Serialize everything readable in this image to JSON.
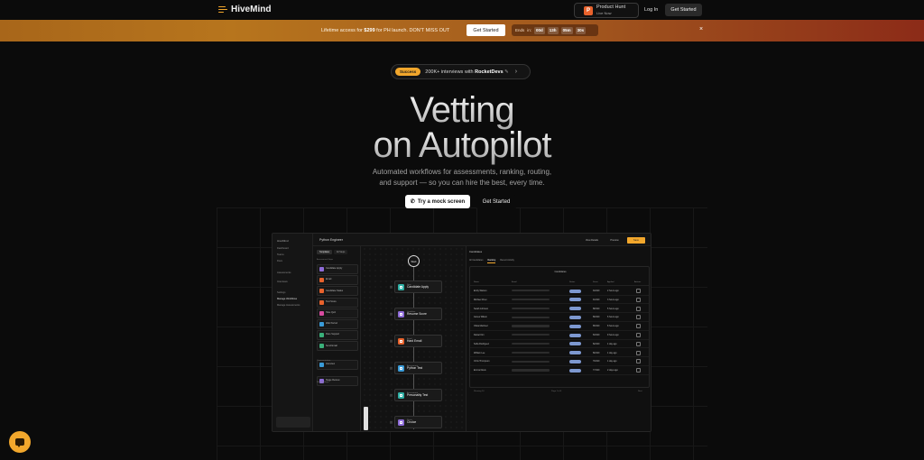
{
  "nav": {
    "brand": "HiveMind",
    "product_hunt_title": "Product Hunt",
    "product_hunt_sub": "Live Now",
    "product_hunt_icon": "P",
    "login": "Log In",
    "get_started": "Get Started"
  },
  "banner": {
    "text_pre": "Lifetime access for ",
    "price": "$299",
    "text_post": " for PH launch. DON'T MISS OUT",
    "button": "Get Started",
    "ends_label": "Ends",
    "ends_in": "in:",
    "days": "00d",
    "hours": "13h",
    "minutes": "05m",
    "seconds": "30s",
    "close": "×"
  },
  "hero": {
    "pill_tag": "Success",
    "pill_text_pre": "200K+ interviews with ",
    "pill_text_bold": "RocketDevs",
    "pill_arrow": "›",
    "title_line1": "Vetting",
    "title_line2": "on Autopilot",
    "subtitle_line1": "Automated workflows for assessments, ranking, routing,",
    "subtitle_line2": "and support — so you can hire the best, every time.",
    "cta_primary": "Try a mock screen",
    "cta_secondary": "Get Started"
  },
  "app": {
    "side_logo": "HiveMind",
    "side_items": [
      "Dashboard",
      "Teams",
      "Docs",
      "Assessments",
      "Interviews",
      "Settings",
      "Manage Workflows",
      "Manage Assessments"
    ],
    "workflow_title": "Python Engineer",
    "top_buttons": [
      "View Details",
      "Preview",
      "Save"
    ],
    "step_tabs": [
      "Templates",
      "All Steps"
    ],
    "steps": [
      {
        "label": "Candidate Apply",
        "color": "#8e6bd8"
      },
      {
        "label": "Email",
        "color": "#e8622c"
      },
      {
        "label": "Candidate Status",
        "color": "#e8622c"
      },
      {
        "label": "Test Score",
        "color": "#e8622c"
      },
      {
        "label": "Take Quiz",
        "color": "#d84ba0"
      },
      {
        "label": "Wait Period",
        "color": "#3a9bd8"
      },
      {
        "label": "Pass Support",
        "color": "#3ab07a"
      },
      {
        "label": "Send Email",
        "color": "#3ab07a"
      },
      {
        "label": "Interview",
        "color": "#3a9bd8"
      },
      {
        "label": "Stage Review",
        "color": "#8e6bd8"
      }
    ],
    "step_sections": [
      "Assessment Steps",
      "Communication",
      "Routing Steps"
    ],
    "start": "Start",
    "nodes": [
      {
        "kind": "Step",
        "label": "Candidate Apply",
        "color": "#2fb0a5"
      },
      {
        "kind": "Condition",
        "label": "Resume Score",
        "color": "#8e6bd8"
      },
      {
        "kind": "Email",
        "label": "Hard Email",
        "color": "#e8622c"
      },
      {
        "kind": "Assessment",
        "label": "Python Test",
        "color": "#3a9bd8"
      },
      {
        "kind": "Assessment",
        "label": "Personality Test",
        "color": "#2fb0a5"
      },
      {
        "kind": "Route",
        "label": "Choice",
        "color": "#8e6bd8"
      }
    ],
    "panel_title": "Candidates",
    "panel_tabs": [
      "All Candidates",
      "Ranking",
      "Recent Activity"
    ],
    "panel_box_title": "Candidates",
    "columns": [
      "Name",
      "Email",
      "Status",
      "Score",
      "Applied",
      "Actions"
    ],
    "rows": [
      {
        "name": "Emily Watson",
        "score": "94/100",
        "date": "2 hours ago"
      },
      {
        "name": "Michael Chen",
        "score": "91/100",
        "date": "3 hours ago"
      },
      {
        "name": "Sarah Johnson",
        "score": "88/100",
        "date": "5 hours ago"
      },
      {
        "name": "James Wilson",
        "score": "86/100",
        "date": "6 hours ago"
      },
      {
        "name": "Olivia Martinez",
        "score": "85/100",
        "date": "8 hours ago"
      },
      {
        "name": "Daniel Kim",
        "score": "83/100",
        "date": "9 hours ago"
      },
      {
        "name": "Sofia Rodriguez",
        "score": "82/100",
        "date": "1 day ago"
      },
      {
        "name": "William Lee",
        "score": "80/100",
        "date": "1 day ago"
      },
      {
        "name": "Chris Thompson",
        "score": "79/100",
        "date": "1 day ago"
      },
      {
        "name": "Emma Davis",
        "score": "77/100",
        "date": "2 days ago"
      }
    ],
    "footer_left": "Showing 10",
    "footer_mid": "Page 1 of 4",
    "footer_right": "Next"
  },
  "colors": {
    "accent": "#f2a72c",
    "background": "#0b0b0b",
    "banner_start": "#a8661a",
    "banner_end": "#8c2b18"
  }
}
